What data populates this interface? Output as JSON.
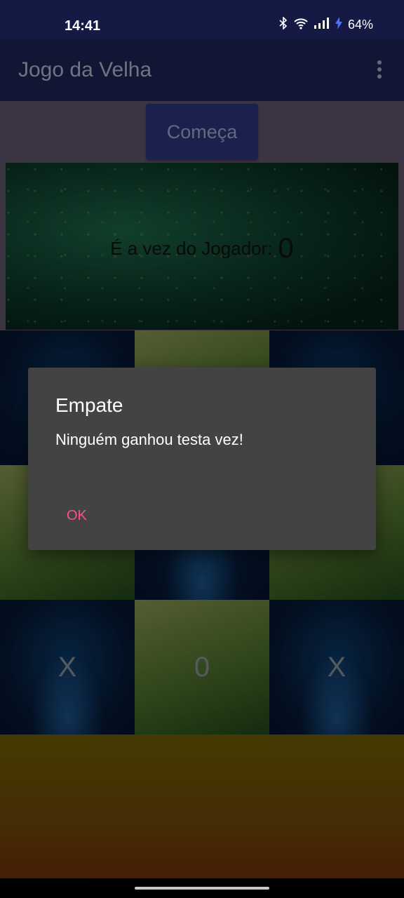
{
  "status_bar": {
    "time": "14:41",
    "battery_percent": "64%",
    "icons": [
      "bluetooth-icon",
      "wifi-icon",
      "signal-icon",
      "charging-icon"
    ]
  },
  "app_bar": {
    "title": "Jogo da Velha",
    "menu_icon": "more-vert-icon"
  },
  "game": {
    "start_button": "Começa",
    "turn_label": "É a vez do Jogador:",
    "current_player": "0",
    "cells": [
      "",
      "",
      "",
      "",
      "",
      "",
      "X",
      "0",
      "X"
    ]
  },
  "dialog": {
    "title": "Empate",
    "message": "Ninguém ganhou testa vez!",
    "ok_label": "OK"
  },
  "colors": {
    "accent": "#ff4f87",
    "app_bar": "#1a2251",
    "dialog_bg": "#434343"
  }
}
